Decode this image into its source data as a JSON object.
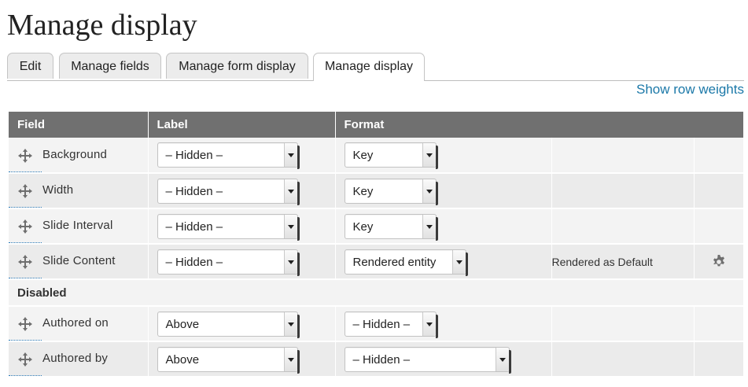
{
  "page": {
    "title": "Manage display"
  },
  "tabs": [
    {
      "label": "Edit",
      "active": false
    },
    {
      "label": "Manage fields",
      "active": false
    },
    {
      "label": "Manage form display",
      "active": false
    },
    {
      "label": "Manage display",
      "active": true
    }
  ],
  "row_weights_link": "Show row weights",
  "table": {
    "headers": {
      "field": "Field",
      "label": "Label",
      "format": "Format"
    },
    "rows": [
      {
        "field": "Background",
        "label": "– Hidden –",
        "format": "Key"
      },
      {
        "field": "Width",
        "label": "– Hidden –",
        "format": "Key"
      },
      {
        "field": "Slide Interval",
        "label": "– Hidden –",
        "format": "Key"
      },
      {
        "field": "Slide Content",
        "label": "– Hidden –",
        "format": "Rendered entity",
        "summary": "Rendered as Default",
        "settings_icon": "gear-icon"
      }
    ],
    "disabled_region": "Disabled",
    "disabled_rows": [
      {
        "field": "Authored on",
        "label": "Above",
        "format": "– Hidden –"
      },
      {
        "field": "Authored by",
        "label": "Above",
        "format": "– Hidden –"
      }
    ]
  },
  "colors": {
    "header_bg": "#707070",
    "link": "#1b78a8",
    "row_bg": "#ebebeb"
  }
}
